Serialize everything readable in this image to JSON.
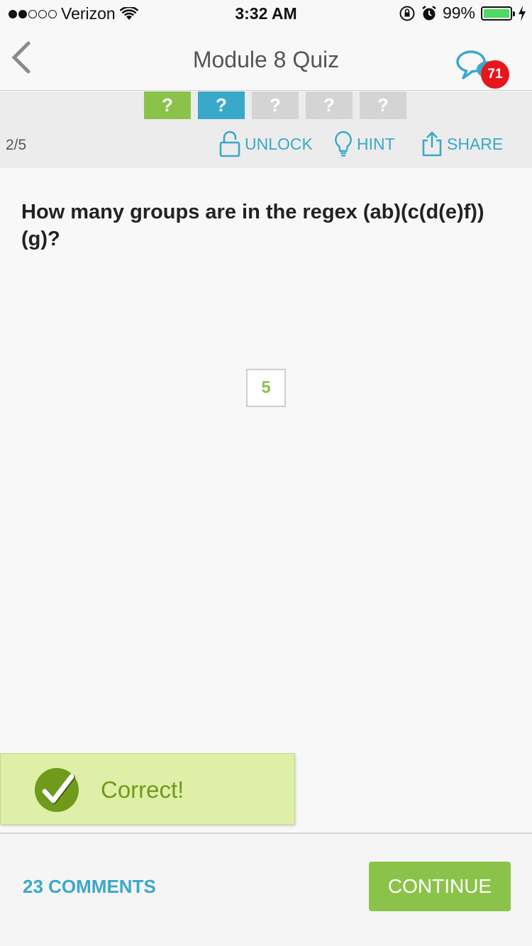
{
  "status_bar": {
    "carrier": "Verizon",
    "time": "3:32 AM",
    "battery_percent": "99%",
    "battery_level": 0.99
  },
  "nav": {
    "title": "Module 8 Quiz",
    "badge_count": "71"
  },
  "progress": {
    "steps": [
      "?",
      "?",
      "?",
      "?",
      "?"
    ],
    "counter": "2/5",
    "actions": {
      "unlock": "UNLOCK",
      "hint": "HINT",
      "share": "SHARE"
    }
  },
  "question": {
    "text": "How many groups are in the regex (ab)(c(d(e)f))(g)?",
    "answer": "5"
  },
  "feedback": {
    "text": "Correct!"
  },
  "footer": {
    "comments_label": "23 COMMENTS",
    "continue_label": "CONTINUE"
  },
  "colors": {
    "accent_blue": "#3aa8c9",
    "accent_green": "#8bc34a",
    "badge_red": "#e8151b",
    "correct_bg": "#dfefa7",
    "correct_text": "#6f9a1a"
  },
  "icons": [
    "back-chevron-icon",
    "chat-bubbles-icon",
    "lock-icon",
    "lightbulb-icon",
    "share-icon",
    "checkmark-icon",
    "wifi-icon",
    "lock-rotation-icon",
    "alarm-icon",
    "charging-bolt-icon"
  ]
}
